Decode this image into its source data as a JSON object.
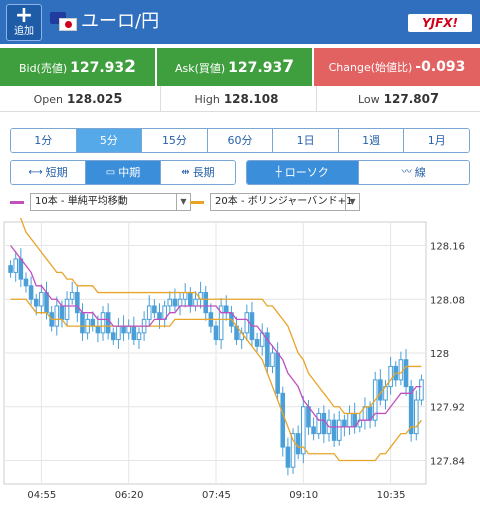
{
  "header": {
    "add_icon": "plus-icon",
    "add_label": "追加",
    "pair": "ユーロ/円",
    "logo_text": "YJFX!",
    "colors": {
      "bar": "#2f6fbe"
    }
  },
  "quotes": {
    "bid_label": "Bid(売値)",
    "bid_main": "127.93",
    "bid_last": "2",
    "ask_label": "Ask(買値)",
    "ask_main": "127.93",
    "ask_last": "7",
    "change_label": "Change(始値比)",
    "change_value": "-0.093",
    "colors": {
      "bid": "#3f9f3f",
      "ask": "#3f9f3f",
      "change": "#e26161"
    }
  },
  "stats": {
    "open_label": "Open",
    "open_main": "128.02",
    "open_last": "5",
    "high_label": "High",
    "high_value": "128.108",
    "low_label": "Low",
    "low_main": "127.80",
    "low_last": "7"
  },
  "timeframes": [
    {
      "label": "1分",
      "active": false
    },
    {
      "label": "5分",
      "active": true
    },
    {
      "label": "15分",
      "active": false
    },
    {
      "label": "60分",
      "active": false
    },
    {
      "label": "1日",
      "active": false
    },
    {
      "label": "1週",
      "active": false
    },
    {
      "label": "1月",
      "active": false
    }
  ],
  "term": {
    "short": "短期",
    "mid": "中期",
    "long": "長期",
    "active": "mid"
  },
  "chart_type": {
    "candle": "ローソク",
    "line": "線",
    "active": "candle"
  },
  "indicators": {
    "ma_select": "10本 - 単純平均移動",
    "ma_color": "#c04fc0",
    "bb_select": "20本 - ボリンジャーバンド+1",
    "bb_color": "#e8a428"
  },
  "chart_data": {
    "type": "candlestick",
    "y_ticks": [
      "128.16",
      "128.08",
      "128",
      "127.92",
      "127.84"
    ],
    "x_ticks": [
      "04:55",
      "06:20",
      "07:45",
      "09:10",
      "10:35"
    ],
    "ylim": [
      127.805,
      128.195
    ],
    "candle_color": "#4a9fd8",
    "close": [
      128.12,
      128.14,
      128.11,
      128.1,
      128.08,
      128.07,
      128.09,
      128.06,
      128.04,
      128.07,
      128.05,
      128.08,
      128.09,
      128.06,
      128.03,
      128.05,
      128.04,
      128.03,
      128.06,
      128.03,
      128.02,
      128.04,
      128.03,
      128.04,
      128.02,
      128.03,
      128.05,
      128.07,
      128.06,
      128.05,
      128.07,
      128.08,
      128.07,
      128.08,
      128.09,
      128.07,
      128.08,
      128.09,
      128.06,
      128.04,
      128.02,
      128.07,
      128.06,
      128.04,
      128.02,
      128.03,
      128.06,
      128.02,
      128.01,
      128.03,
      127.98,
      128.0,
      127.94,
      127.86,
      127.83,
      127.88,
      127.85,
      127.92,
      127.89,
      127.88,
      127.91,
      127.88,
      127.9,
      127.87,
      127.9,
      127.89,
      127.91,
      127.89,
      127.9,
      127.92,
      127.9,
      127.96,
      127.93,
      127.95,
      127.98,
      127.96,
      127.99,
      127.95,
      127.88,
      127.93,
      127.96
    ],
    "ma10": [
      128.16,
      128.15,
      128.14,
      128.13,
      128.12,
      128.1,
      128.1,
      128.09,
      128.08,
      128.08,
      128.07,
      128.07,
      128.07,
      128.07,
      128.06,
      128.06,
      128.06,
      128.05,
      128.05,
      128.05,
      128.04,
      128.04,
      128.04,
      128.04,
      128.04,
      128.04,
      128.04,
      128.04,
      128.05,
      128.05,
      128.05,
      128.06,
      128.06,
      128.07,
      128.07,
      128.07,
      128.07,
      128.07,
      128.07,
      128.07,
      128.07,
      128.06,
      128.06,
      128.06,
      128.05,
      128.05,
      128.05,
      128.04,
      128.04,
      128.03,
      128.02,
      128.01,
      128.0,
      127.99,
      127.97,
      127.96,
      127.95,
      127.93,
      127.92,
      127.91,
      127.9,
      127.9,
      127.89,
      127.89,
      127.89,
      127.89,
      127.89,
      127.89,
      127.9,
      127.9,
      127.9,
      127.91,
      127.91,
      127.91,
      127.92,
      127.93,
      127.94,
      127.94,
      127.94,
      127.95,
      127.95
    ],
    "bb_upper": [
      128.24,
      128.22,
      128.2,
      128.18,
      128.17,
      128.16,
      128.15,
      128.14,
      128.13,
      128.12,
      128.12,
      128.11,
      128.11,
      128.1,
      128.1,
      128.1,
      128.1,
      128.09,
      128.09,
      128.09,
      128.09,
      128.09,
      128.09,
      128.09,
      128.09,
      128.09,
      128.09,
      128.09,
      128.09,
      128.09,
      128.09,
      128.09,
      128.09,
      128.09,
      128.09,
      128.09,
      128.09,
      128.08,
      128.08,
      128.08,
      128.08,
      128.08,
      128.08,
      128.08,
      128.08,
      128.08,
      128.08,
      128.08,
      128.08,
      128.08,
      128.07,
      128.07,
      128.06,
      128.05,
      128.04,
      128.02,
      128.0,
      127.99,
      127.97,
      127.96,
      127.95,
      127.94,
      127.93,
      127.92,
      127.92,
      127.91,
      127.91,
      127.91,
      127.91,
      127.92,
      127.92,
      127.93,
      127.94,
      127.95,
      127.96,
      127.97,
      127.97,
      127.98,
      127.98,
      127.98,
      127.98
    ],
    "bb_lower": [
      128.08,
      128.08,
      128.08,
      128.08,
      128.07,
      128.06,
      128.06,
      128.06,
      128.05,
      128.05,
      128.05,
      128.04,
      128.04,
      128.04,
      128.04,
      128.04,
      128.04,
      128.04,
      128.04,
      128.04,
      128.04,
      128.04,
      128.04,
      128.04,
      128.04,
      128.04,
      128.04,
      128.04,
      128.04,
      128.04,
      128.04,
      128.04,
      128.05,
      128.05,
      128.05,
      128.05,
      128.05,
      128.05,
      128.05,
      128.05,
      128.05,
      128.05,
      128.05,
      128.05,
      128.04,
      128.03,
      128.02,
      128.01,
      128.0,
      127.99,
      127.97,
      127.95,
      127.93,
      127.91,
      127.89,
      127.87,
      127.86,
      127.86,
      127.85,
      127.85,
      127.85,
      127.85,
      127.85,
      127.85,
      127.84,
      127.84,
      127.84,
      127.84,
      127.84,
      127.84,
      127.84,
      127.84,
      127.85,
      127.85,
      127.86,
      127.87,
      127.88,
      127.88,
      127.89,
      127.89,
      127.9
    ]
  }
}
